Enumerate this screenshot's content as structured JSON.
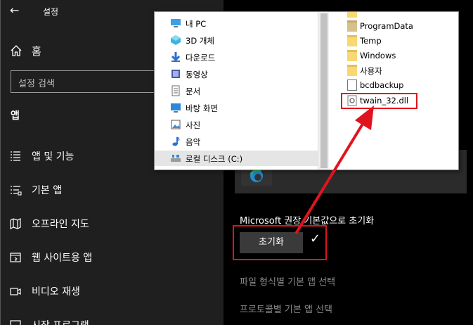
{
  "window": {
    "title": "설정",
    "back_icon": "back-arrow-icon"
  },
  "sidebar": {
    "home_label": "홈",
    "search_placeholder": "설정 검색",
    "section_title": "앱",
    "items": [
      {
        "label": "앱 및 기능",
        "icon": "apps-features-icon"
      },
      {
        "label": "기본 앱",
        "icon": "default-apps-icon"
      },
      {
        "label": "오프라인 지도",
        "icon": "offline-maps-icon"
      },
      {
        "label": "웹 사이트용 앱",
        "icon": "apps-for-websites-icon"
      },
      {
        "label": "비디오 재생",
        "icon": "video-playback-icon"
      },
      {
        "label": "시작 프로그램",
        "icon": "startup-icon"
      }
    ]
  },
  "main": {
    "reset_label": "Microsoft 권장 기본값으로 초기화",
    "reset_button": "초기화",
    "links": [
      "파일 형식별 기본 앱 선택",
      "프로토콜별 기본 앱 선택"
    ]
  },
  "explorer": {
    "tree": [
      {
        "label": "내 PC",
        "icon": "pc-icon"
      },
      {
        "label": "3D 개체",
        "icon": "3d-objects-icon"
      },
      {
        "label": "다운로드",
        "icon": "downloads-icon"
      },
      {
        "label": "동영상",
        "icon": "videos-icon"
      },
      {
        "label": "문서",
        "icon": "documents-icon"
      },
      {
        "label": "바탕 화면",
        "icon": "desktop-icon"
      },
      {
        "label": "사진",
        "icon": "pictures-icon"
      },
      {
        "label": "음악",
        "icon": "music-icon"
      },
      {
        "label": "로컬 디스크 (C:)",
        "icon": "local-disk-icon"
      }
    ],
    "files": [
      {
        "label": "ProgramData",
        "icon": "folder-icon"
      },
      {
        "label": "Temp",
        "icon": "folder-icon"
      },
      {
        "label": "Windows",
        "icon": "folder-icon"
      },
      {
        "label": "사용자",
        "icon": "folder-icon"
      },
      {
        "label": "bcdbackup",
        "icon": "file-icon"
      },
      {
        "label": "twain_32.dll",
        "icon": "dll-file-icon"
      }
    ]
  },
  "colors": {
    "highlight_red": "#e0141e",
    "sidebar_bg": "#1f1f1f",
    "selection_blue": "#cce8ff"
  }
}
